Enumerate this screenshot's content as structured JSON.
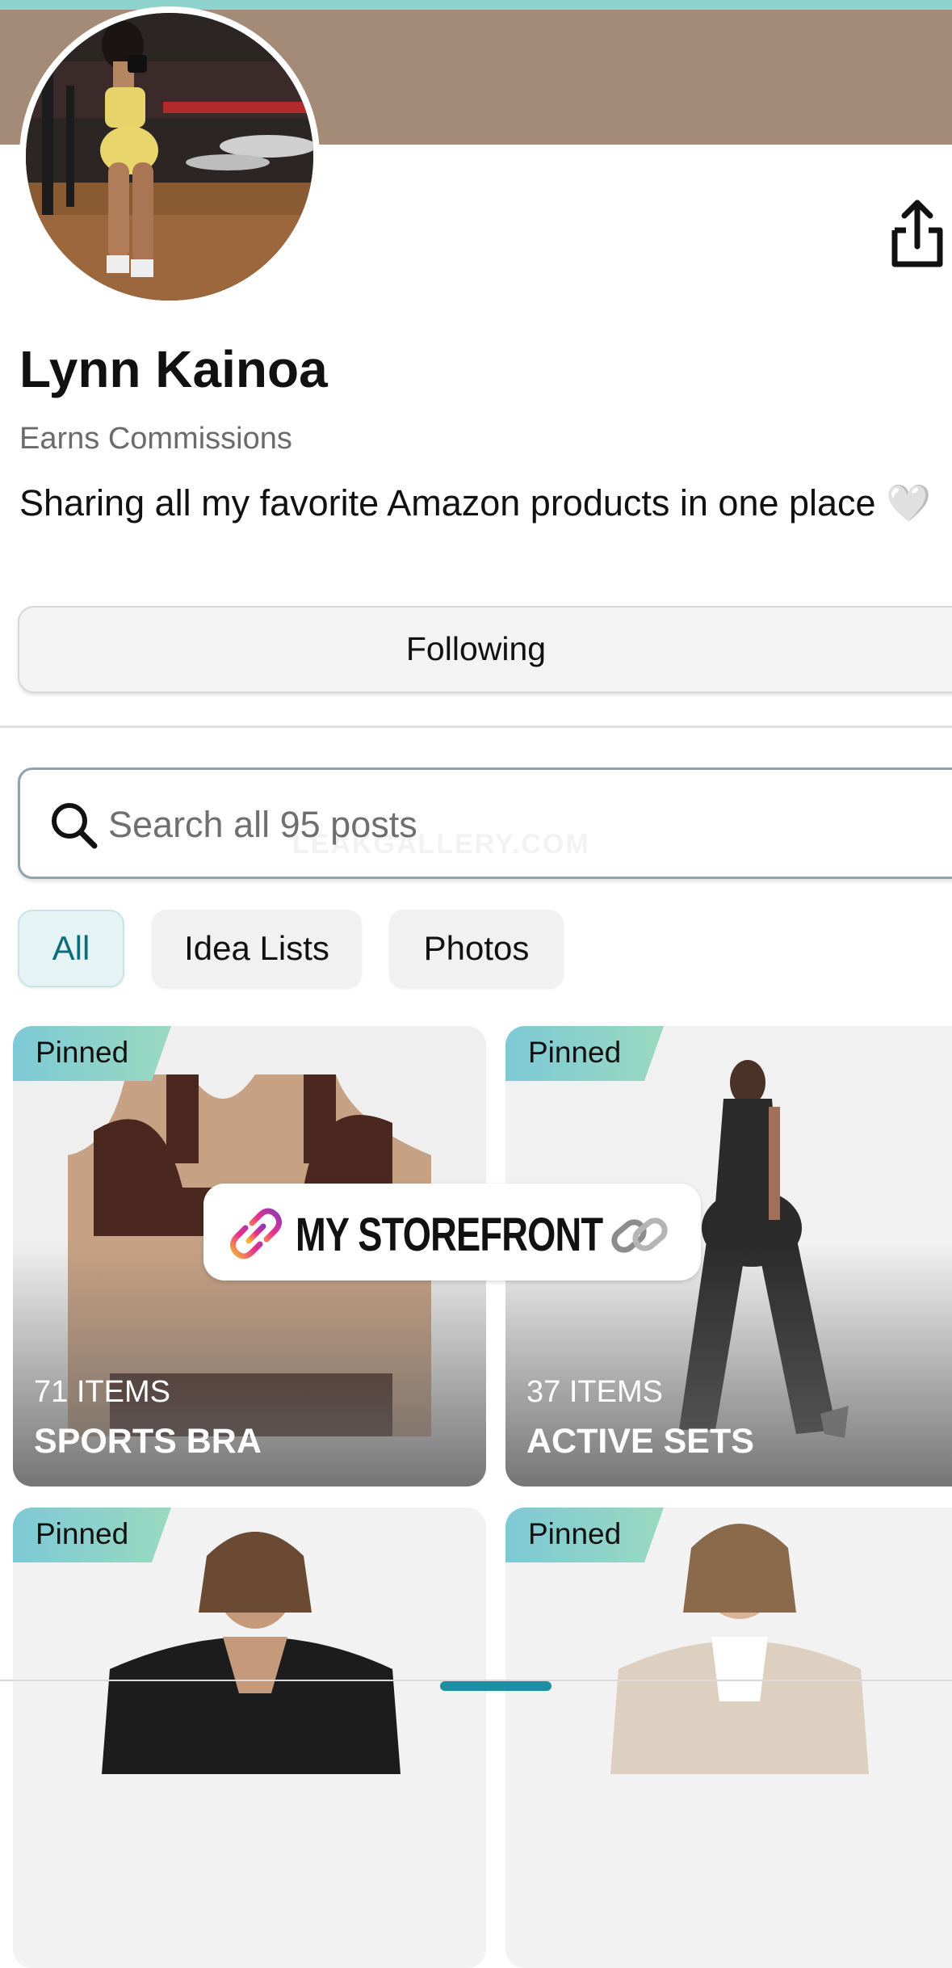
{
  "profile": {
    "name": "Lynn Kainoa",
    "badge": "Earns Commissions",
    "bio": "Sharing all my favorite Amazon products in one place 🤍",
    "follow_label": "Following"
  },
  "search": {
    "placeholder": "Search all 95 posts"
  },
  "watermark": "LEAKGALLERY.COM",
  "filters": [
    {
      "label": "All",
      "active": true
    },
    {
      "label": "Idea Lists",
      "active": false
    },
    {
      "label": "Photos",
      "active": false
    }
  ],
  "cards": [
    {
      "tag": "Pinned",
      "count": "71 ITEMS",
      "title": "SPORTS BRA"
    },
    {
      "tag": "Pinned",
      "count": "37 ITEMS",
      "title": "ACTIVE SETS"
    },
    {
      "tag": "Pinned",
      "count": "",
      "title": ""
    },
    {
      "tag": "Pinned",
      "count": "",
      "title": ""
    }
  ],
  "overlay": {
    "storefront_label": "MY STOREFRONT"
  },
  "colors": {
    "banner": "#a38b78",
    "accent_teal": "#0c6e7d",
    "pinned_gradient_start": "#7dc9d6",
    "pinned_gradient_end": "#9ad9c0"
  },
  "icons": {
    "share": "share-icon",
    "search": "search-icon",
    "link": "link-icon",
    "chain": "chain-icon"
  }
}
